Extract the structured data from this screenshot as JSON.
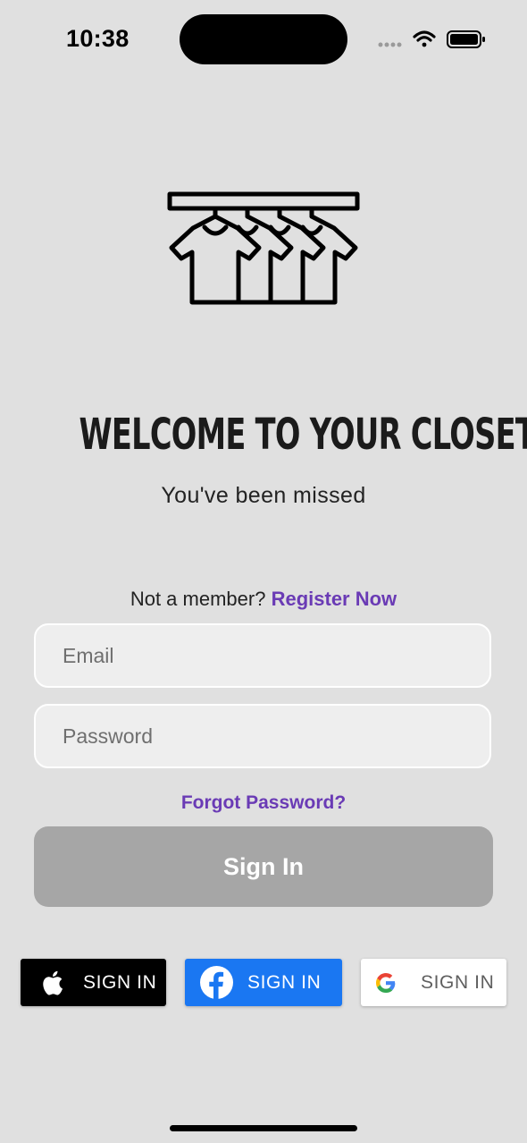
{
  "status_bar": {
    "time": "10:38",
    "icons": [
      "cellular-icon",
      "wifi-icon",
      "battery-icon"
    ]
  },
  "logo": {
    "icon": "clothes-rack-icon"
  },
  "welcome": {
    "title": "WELCOME TO YOUR CLOSET!",
    "subtitle": "You've been missed"
  },
  "register": {
    "prompt": "Not a member?",
    "link": "Register Now"
  },
  "form": {
    "email_placeholder": "Email",
    "email_value": "",
    "password_placeholder": "Password",
    "password_value": "",
    "forgot_label": "Forgot Password?",
    "submit_label": "Sign In"
  },
  "social": {
    "apple_label": "SIGN IN",
    "facebook_label": "SIGN IN",
    "google_label": "SIGN IN"
  },
  "colors": {
    "background": "#e0e0e0",
    "accent": "#6a3bb5",
    "button_disabled": "#a6a6a6",
    "facebook": "#1a77f2"
  }
}
